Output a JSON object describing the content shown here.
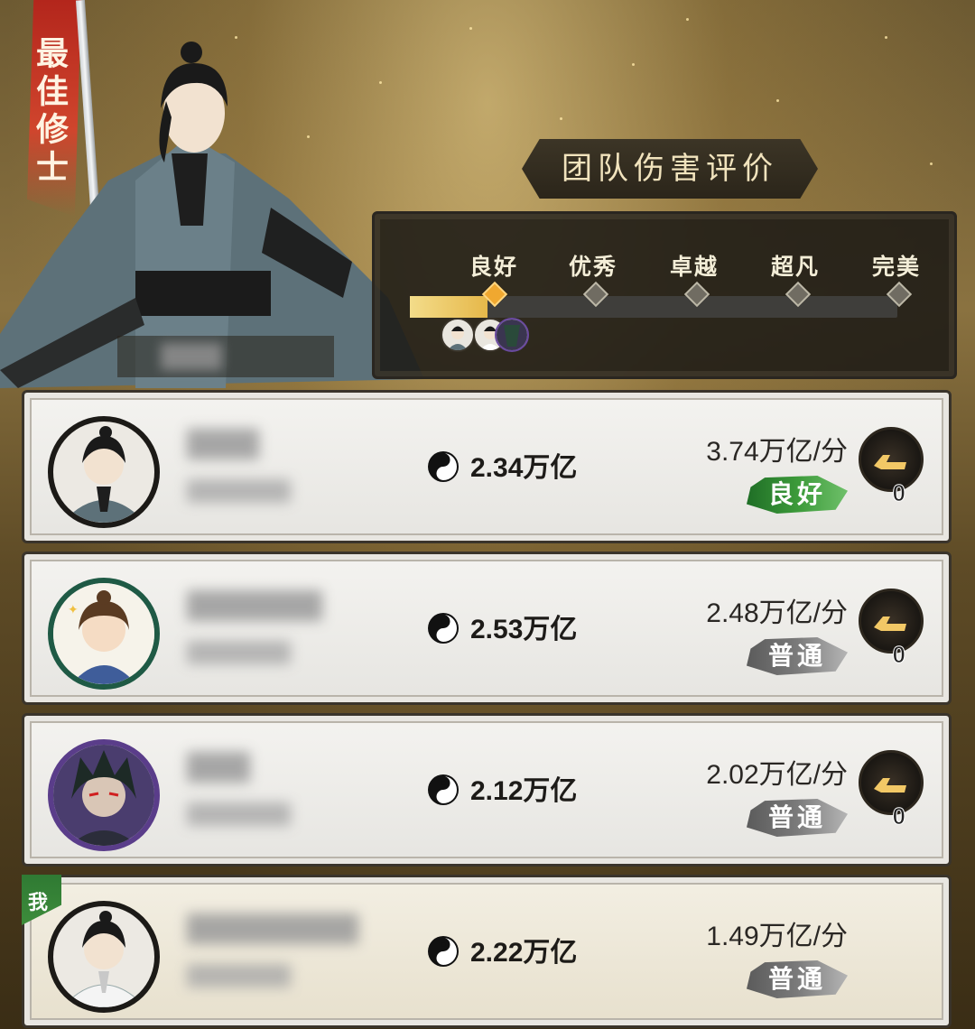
{
  "hero": {
    "banner_text": "最佳修士"
  },
  "rating": {
    "title": "团队伤害评价",
    "levels": [
      "良好",
      "优秀",
      "卓越",
      "超凡",
      "完美"
    ],
    "progress_fraction": 0.16
  },
  "players": [
    {
      "damage": "2.34万亿",
      "dps": "3.74万亿/分",
      "grade": "良好",
      "grade_style": "good",
      "likes": "0",
      "is_me": false,
      "avatar": "swordsman-avatar"
    },
    {
      "damage": "2.53万亿",
      "dps": "2.48万亿/分",
      "grade": "普通",
      "grade_style": "normal",
      "likes": "0",
      "is_me": false,
      "avatar": "chibi-girl-avatar"
    },
    {
      "damage": "2.12万亿",
      "dps": "2.02万亿/分",
      "grade": "普通",
      "grade_style": "normal",
      "likes": "0",
      "is_me": false,
      "avatar": "demon-avatar"
    },
    {
      "damage": "2.22万亿",
      "dps": "1.49万亿/分",
      "grade": "普通",
      "grade_style": "normal",
      "likes": "",
      "is_me": true,
      "me_label": "我",
      "avatar": "white-robe-avatar"
    }
  ],
  "colors": {
    "grade_good": "#3c9a3a",
    "grade_normal": "#7a7a7a",
    "progress_fill": "#e6b84a"
  }
}
